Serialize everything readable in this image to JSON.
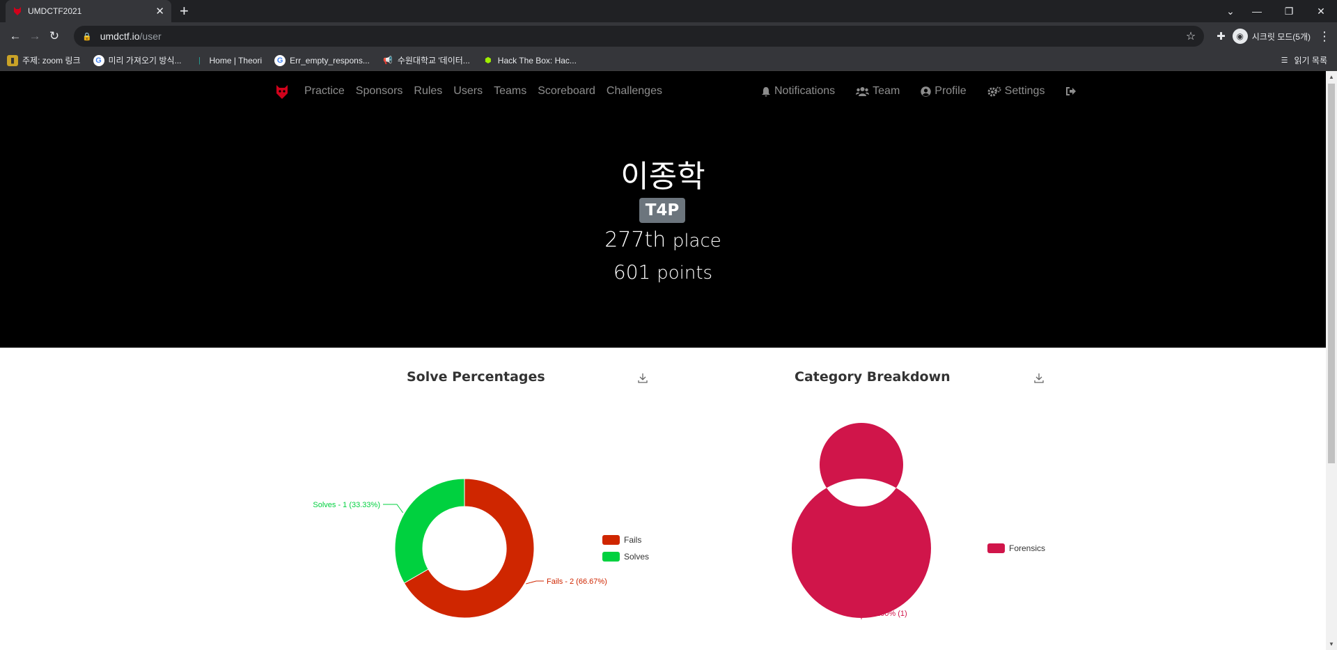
{
  "browser": {
    "tab_title": "UMDCTF2021",
    "url_host": "umdctf.io",
    "url_path": "/user",
    "incognito_label": "시크릿 모드(5개)",
    "bookmarks": [
      {
        "label": "주제: zoom 링크"
      },
      {
        "label": "미리 가져오기 방식..."
      },
      {
        "label": "Home | Theori"
      },
      {
        "label": "Err_empty_respons..."
      },
      {
        "label": "수원대학교 '데이터..."
      },
      {
        "label": "Hack The Box: Hac..."
      }
    ],
    "reading_list": "읽기 목록"
  },
  "nav": {
    "links": [
      "Practice",
      "Sponsors",
      "Rules",
      "Users",
      "Teams",
      "Scoreboard",
      "Challenges"
    ],
    "right": {
      "notifications": "Notifications",
      "team": "Team",
      "profile": "Profile",
      "settings": "Settings"
    }
  },
  "profile": {
    "name": "이종학",
    "team": "T4P",
    "place_value": "277th",
    "place_label": "place",
    "points_value": "601",
    "points_label": "points"
  },
  "colors": {
    "fails": "#cf2600",
    "solves": "#00d13f",
    "forensics": "#d0154a"
  },
  "chart_data": [
    {
      "type": "pie",
      "title": "Solve Percentages",
      "categories": [
        "Fails",
        "Solves"
      ],
      "values": [
        2,
        1
      ],
      "labels": [
        "Fails - 2 (66.67%)",
        "Solves - 1 (33.33%)"
      ],
      "legend": "right"
    },
    {
      "type": "pie",
      "title": "Category Breakdown",
      "categories": [
        "Forensics"
      ],
      "values": [
        1
      ],
      "labels": [
        "100% (1)"
      ],
      "legend": "right"
    }
  ]
}
